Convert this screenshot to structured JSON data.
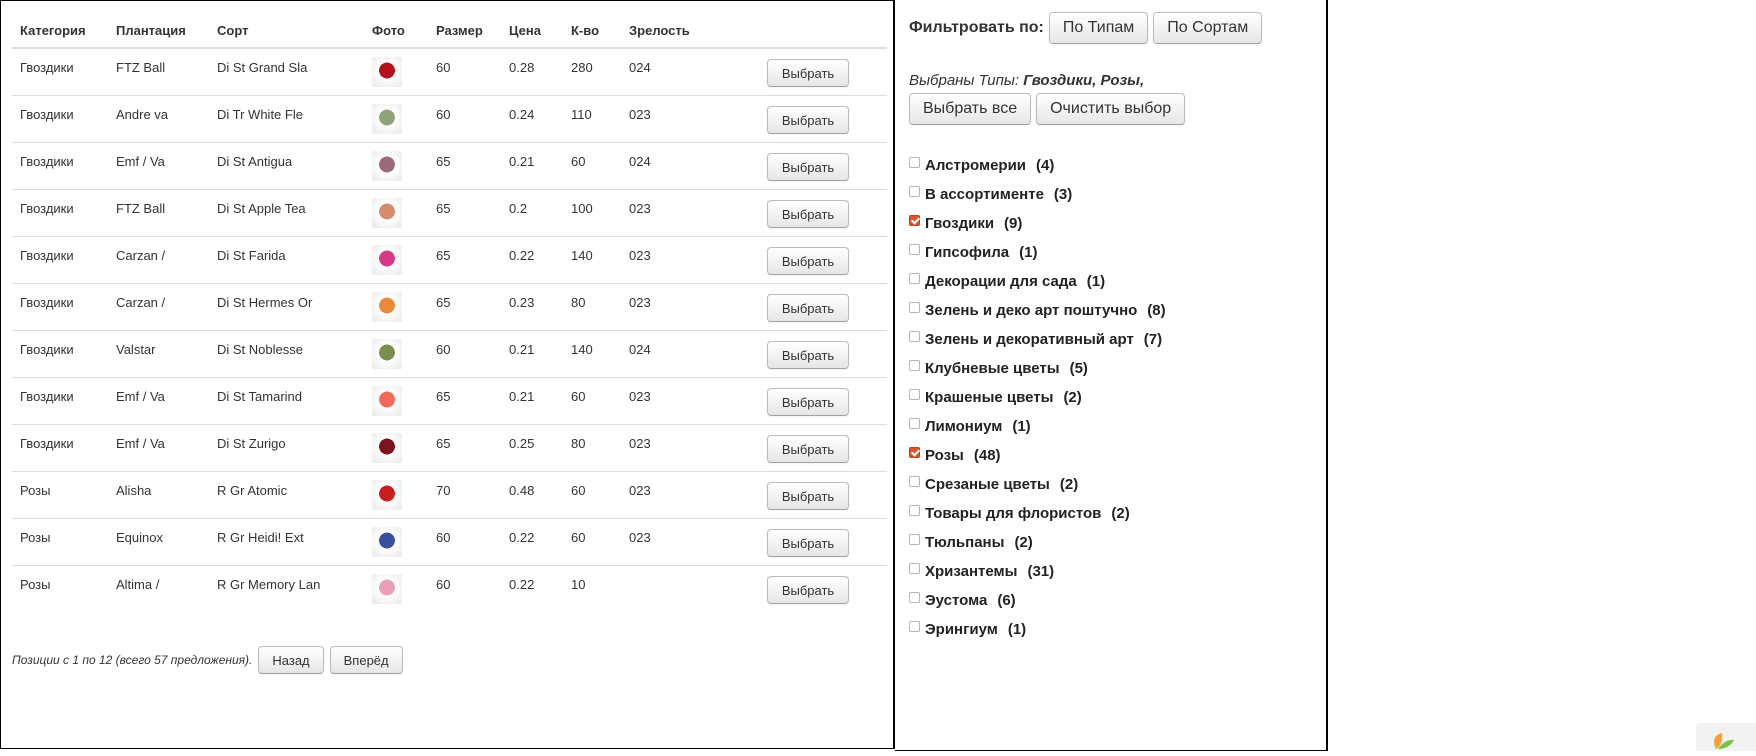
{
  "table": {
    "headers": [
      "Категория",
      "Плантация",
      "Сорт",
      "Фото",
      "Размер",
      "Цена",
      "К-во",
      "Зрелость"
    ],
    "select_label": "Выбрать",
    "rows": [
      {
        "category": "Гвоздики",
        "plantation": "FTZ Ball",
        "variety": "Di St Grand Sla",
        "photo_color": "#b3121b",
        "size": "60",
        "price": "0.28",
        "qty": "280",
        "maturity": "024"
      },
      {
        "category": "Гвоздики",
        "plantation": "Andre va",
        "variety": "Di Tr White Fle",
        "photo_color": "#8fa37a",
        "size": "60",
        "price": "0.24",
        "qty": "110",
        "maturity": "023"
      },
      {
        "category": "Гвоздики",
        "plantation": "Emf / Va",
        "variety": "Di St Antigua",
        "photo_color": "#9c6a7a",
        "size": "65",
        "price": "0.21",
        "qty": "60",
        "maturity": "024"
      },
      {
        "category": "Гвоздики",
        "plantation": "FTZ Ball",
        "variety": "Di St Apple Tea",
        "photo_color": "#d88a6c",
        "size": "65",
        "price": "0.2",
        "qty": "100",
        "maturity": "023"
      },
      {
        "category": "Гвоздики",
        "plantation": "Carzan /",
        "variety": "Di St Farida",
        "photo_color": "#d63a86",
        "size": "65",
        "price": "0.22",
        "qty": "140",
        "maturity": "023"
      },
      {
        "category": "Гвоздики",
        "plantation": "Carzan /",
        "variety": "Di St Hermes Or",
        "photo_color": "#e88a3a",
        "size": "65",
        "price": "0.23",
        "qty": "80",
        "maturity": "023"
      },
      {
        "category": "Гвоздики",
        "plantation": "Valstar",
        "variety": "Di St Noblesse",
        "photo_color": "#7a8f4e",
        "size": "60",
        "price": "0.21",
        "qty": "140",
        "maturity": "024"
      },
      {
        "category": "Гвоздики",
        "plantation": "Emf / Va",
        "variety": "Di St Tamarind",
        "photo_color": "#f06a5a",
        "size": "65",
        "price": "0.21",
        "qty": "60",
        "maturity": "023"
      },
      {
        "category": "Гвоздики",
        "plantation": "Emf / Va",
        "variety": "Di St Zurigo",
        "photo_color": "#7a1420",
        "size": "65",
        "price": "0.25",
        "qty": "80",
        "maturity": "023"
      },
      {
        "category": "Розы",
        "plantation": "Alisha",
        "variety": "R Gr Atomic",
        "photo_color": "#c81e1e",
        "size": "70",
        "price": "0.48",
        "qty": "60",
        "maturity": "023"
      },
      {
        "category": "Розы",
        "plantation": "Equinox",
        "variety": "R Gr Heidi! Ext",
        "photo_color": "#3a4fa0",
        "size": "60",
        "price": "0.22",
        "qty": "60",
        "maturity": "023"
      },
      {
        "category": "Розы",
        "plantation": "Altima /",
        "variety": "R Gr Memory Lan",
        "photo_color": "#e8a0b4",
        "size": "60",
        "price": "0.22",
        "qty": "10",
        "maturity": ""
      }
    ]
  },
  "pager": {
    "info": "Позиции с 1 по 12 (всего 57 предложения).",
    "back_label": "Назад",
    "forward_label": "Вперёд"
  },
  "filter": {
    "label": "Фильтровать по:",
    "by_types_label": "По Типам",
    "by_varieties_label": "По Сортам",
    "selected_prefix": "Выбраны Типы:",
    "selected_values": "Гвоздики, Розы,",
    "select_all_label": "Выбрать все",
    "clear_label": "Очистить выбор",
    "types": [
      {
        "name": "Алстромерии",
        "count": "(4)",
        "checked": false
      },
      {
        "name": "В ассортименте",
        "count": "(3)",
        "checked": false
      },
      {
        "name": "Гвоздики",
        "count": "(9)",
        "checked": true
      },
      {
        "name": "Гипсофила",
        "count": "(1)",
        "checked": false
      },
      {
        "name": "Декорации для сада",
        "count": "(1)",
        "checked": false
      },
      {
        "name": "Зелень и деко арт поштучно",
        "count": "(8)",
        "checked": false
      },
      {
        "name": "Зелень и декоративный арт",
        "count": "(7)",
        "checked": false
      },
      {
        "name": "Клубневые цветы",
        "count": "(5)",
        "checked": false
      },
      {
        "name": "Крашеные цветы",
        "count": "(2)",
        "checked": false
      },
      {
        "name": "Лимониум",
        "count": "(1)",
        "checked": false
      },
      {
        "name": "Розы",
        "count": "(48)",
        "checked": true
      },
      {
        "name": "Срезаные цветы",
        "count": "(2)",
        "checked": false
      },
      {
        "name": "Товары для флористов",
        "count": "(2)",
        "checked": false
      },
      {
        "name": "Тюльпаны",
        "count": "(2)",
        "checked": false
      },
      {
        "name": "Хризантемы",
        "count": "(31)",
        "checked": false
      },
      {
        "name": "Эустома",
        "count": "(6)",
        "checked": false
      },
      {
        "name": "Эрингиум",
        "count": "(1)",
        "checked": false
      }
    ]
  },
  "colors": {
    "checkbox_checked": "#d9552b",
    "header_border": "#dddddd"
  }
}
